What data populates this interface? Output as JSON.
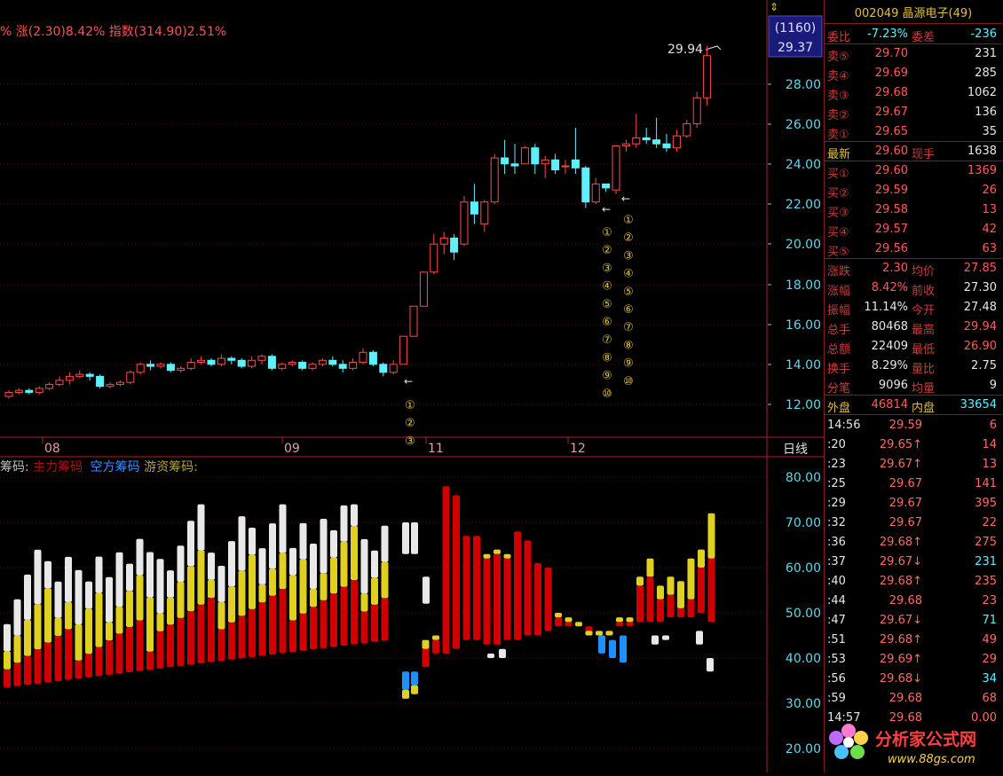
{
  "header": {
    "change_text": "% 涨(2.30)8.42% 指数(314.90)2.51%",
    "last_label_1": "(1160)",
    "last_label_2": "29.37",
    "high_label": "29.94",
    "period_label": "日线",
    "indicator_prefix": "筹码:",
    "indicator_main": "主力筹码",
    "indicator_short": "空方筹码",
    "indicator_hot": "游资筹码:"
  },
  "price_axis": [
    "28.00",
    "26.00",
    "24.00",
    "22.00",
    "20.00",
    "18.00",
    "16.00",
    "14.00",
    "12.00"
  ],
  "indicator_axis": [
    "80.00",
    "70.00",
    "60.00",
    "50.00",
    "40.00",
    "30.00",
    "20.00"
  ],
  "months": [
    "08",
    "09",
    "11",
    "12"
  ],
  "circle_nums": [
    "①",
    "②",
    "③",
    "④",
    "⑤",
    "⑥",
    "⑦",
    "⑧",
    "⑨",
    "⑩"
  ],
  "quote": {
    "title": "002049 晶源电子(49)",
    "wb": {
      "l": "委比",
      "v": "-7.23%",
      "l2": "委差",
      "v2": "-236"
    },
    "asks": [
      {
        "l": "卖⑤",
        "p": "29.70",
        "q": "231"
      },
      {
        "l": "卖④",
        "p": "29.69",
        "q": "285"
      },
      {
        "l": "卖③",
        "p": "29.68",
        "q": "1062"
      },
      {
        "l": "卖②",
        "p": "29.67",
        "q": "136"
      },
      {
        "l": "卖①",
        "p": "29.65",
        "q": "35"
      }
    ],
    "latest": {
      "l": "最新",
      "v": "29.60",
      "l2": "现手",
      "v2": "1638"
    },
    "bids": [
      {
        "l": "买①",
        "p": "29.60",
        "q": "1369"
      },
      {
        "l": "买②",
        "p": "29.59",
        "q": "26"
      },
      {
        "l": "买③",
        "p": "29.58",
        "q": "13"
      },
      {
        "l": "买④",
        "p": "29.57",
        "q": "42"
      },
      {
        "l": "买⑤",
        "p": "29.56",
        "q": "63"
      }
    ],
    "stats": [
      {
        "l": "涨跌",
        "v": "2.30",
        "l2": "均价",
        "v2": "27.85"
      },
      {
        "l": "涨幅",
        "v": "8.42%",
        "l2": "前收",
        "v2": "27.30"
      },
      {
        "l": "振幅",
        "v": "11.14%",
        "l2": "今开",
        "v2": "27.48"
      },
      {
        "l": "总手",
        "v": "80468",
        "l2": "最高",
        "v2": "29.94"
      },
      {
        "l": "总额",
        "v": "22409",
        "l2": "最低",
        "v2": "26.90"
      },
      {
        "l": "换手",
        "v": "8.29%",
        "l2": "量比",
        "v2": "2.75"
      },
      {
        "l": "分笔",
        "v": "9096",
        "l2": "均量",
        "v2": "9"
      }
    ],
    "outer": {
      "l": "外盘",
      "v": "46814",
      "l2": "内盘",
      "v2": "33654"
    }
  },
  "ticks": [
    {
      "t": "14:56",
      "p": "29.59",
      "v": "6",
      "g": false
    },
    {
      "t": ":20",
      "p": "29.65↑",
      "v": "14",
      "g": false
    },
    {
      "t": ":23",
      "p": "29.67↑",
      "v": "13",
      "g": false
    },
    {
      "t": ":25",
      "p": "29.67",
      "v": "141",
      "g": false
    },
    {
      "t": ":29",
      "p": "29.67",
      "v": "395",
      "g": false
    },
    {
      "t": ":32",
      "p": "29.67",
      "v": "22",
      "g": false
    },
    {
      "t": ":36",
      "p": "29.68↑",
      "v": "275",
      "g": false
    },
    {
      "t": ":37",
      "p": "29.67↓",
      "v": "231",
      "g": true
    },
    {
      "t": ":40",
      "p": "29.68↑",
      "v": "235",
      "g": false
    },
    {
      "t": ":44",
      "p": "29.68",
      "v": "23",
      "g": false
    },
    {
      "t": ":47",
      "p": "29.67↓",
      "v": "71",
      "g": true
    },
    {
      "t": ":51",
      "p": "29.68↑",
      "v": "49",
      "g": false
    },
    {
      "t": ":53",
      "p": "29.69↑",
      "v": "29",
      "g": false
    },
    {
      "t": ":56",
      "p": "29.68↓",
      "v": "34",
      "g": true
    },
    {
      "t": ":59",
      "p": "29.68",
      "v": "68",
      "g": false
    },
    {
      "t": "14:57",
      "p": "29.68",
      "v": "0.00",
      "g": false
    }
  ],
  "logo": {
    "text": "分析家公式网",
    "url": "www.88gs.com"
  },
  "colors": {
    "up": "#ff4a4a",
    "down": "#5ff0ff",
    "main": "#d00000",
    "hot": "#e0d020",
    "white": "#e8e8e8",
    "short": "#1e90ff"
  }
}
